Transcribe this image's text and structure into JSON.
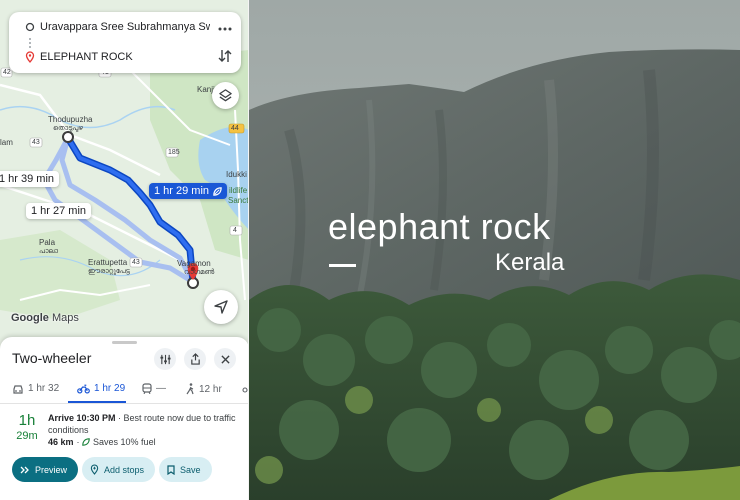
{
  "directions": {
    "origin": "Uravappara Sree Subrahmanya Sw...",
    "destination": "ELEPHANT ROCK",
    "more_icon": "more-vert-icon",
    "swap_icon": "swap-vert-icon"
  },
  "map": {
    "places": {
      "thodupuzha": "Thodupuzha",
      "thodupuzha_local": "തൊടുപുഴ",
      "kanji": "Kanji",
      "idukki": "Idukki",
      "wildlife": "ildlife",
      "sanctuary": "Sanctua",
      "pala": "Pala",
      "pala_local": "പാലാ",
      "erattupetta": "Erattupetta",
      "erattupetta_local": "ഈരാറ്റുപേട്ട",
      "vagamon": "Vagamon",
      "vagamon_local": "വാഗമൺ",
      "lam": "lam"
    },
    "road_numbers": [
      "42",
      "43",
      "41",
      "185",
      "44",
      "43",
      "4"
    ],
    "route_labels": {
      "alt1": "1 hr 39 min",
      "alt2": "1 hr 27 min",
      "selected": "1 hr 29 min"
    },
    "brand_google": "Google",
    "brand_maps": "Maps"
  },
  "panel": {
    "title": "Two-wheeler",
    "modes": [
      {
        "icon": "car-icon",
        "label": "1 hr 32"
      },
      {
        "icon": "motorbike-icon",
        "label": "1 hr 29"
      },
      {
        "icon": "transit-icon",
        "label": "—"
      },
      {
        "icon": "walk-icon",
        "label": "12 hr"
      }
    ],
    "time_hours": "1h",
    "time_minutes": "29m",
    "arrive": "Arrive 10:30 PM",
    "arrive_note": " · Best route now due to traffic conditions",
    "distance": "46 km",
    "fuel": "Saves 10% fuel",
    "buttons": {
      "preview": "Preview",
      "add_stops": "Add stops",
      "save": "Save"
    }
  },
  "photo": {
    "title": "elephant rock",
    "subtitle": "Kerala"
  },
  "colors": {
    "route_blue": "#1a57d6",
    "alt_route": "#a8bff0",
    "primary_button": "#0b6f82",
    "duration_green": "#188038",
    "destination_pin": "#e53935"
  }
}
